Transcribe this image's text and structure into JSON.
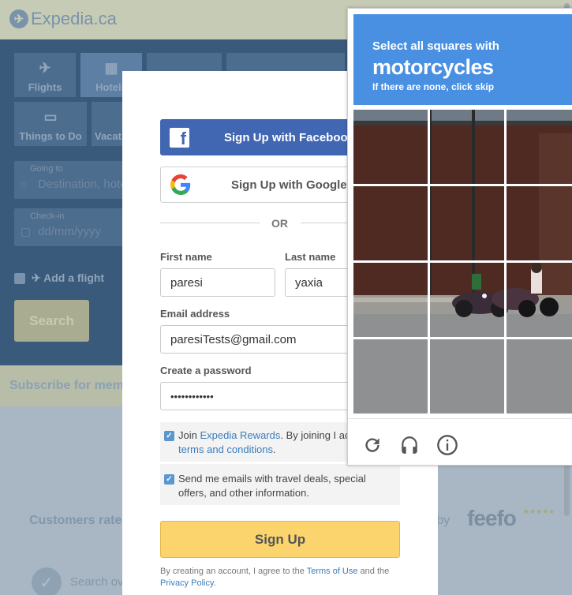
{
  "background": {
    "logo_text": "Expedia.ca",
    "tabs": [
      {
        "label": "Flights",
        "icon": "airplane-icon"
      },
      {
        "label": "Hotels",
        "icon": "hotel-icon"
      },
      {
        "label": "Things to Do",
        "icon": "ticket-icon"
      },
      {
        "label": "Vacations",
        "icon": "vacation-icon"
      }
    ],
    "going_to_label": "Going to",
    "going_to_placeholder": "Destination, hotel name",
    "checkin_label": "Check-in",
    "checkin_placeholder": "dd/mm/yyyy",
    "add_flight": "Add a flight",
    "search_button": "Search",
    "subscribe_text": "Subscribe for members",
    "customers_rated": "Customers rated",
    "rated_by": "d by",
    "feefo": "feefo",
    "search_over": "Search ov"
  },
  "signup": {
    "facebook_button": "Sign Up with Facebook",
    "google_button": "Sign Up with Google",
    "or_text": "OR",
    "first_name_label": "First name",
    "first_name_value": "paresi",
    "last_name_label": "Last name",
    "last_name_value": "yaxia",
    "email_label": "Email address",
    "email_value": "paresiTests@gmail.com",
    "password_label": "Create a password",
    "password_value": "••••••••••••",
    "rewards_pre": "Join ",
    "rewards_link": "Expedia Rewards",
    "rewards_post": ". By joining I ac",
    "rewards_terms": "terms and conditions",
    "rewards_end": ".",
    "rewards_checked": true,
    "emails_text": "Send me emails with travel deals, special offers, and other information.",
    "emails_checked": true,
    "signup_button": "Sign Up",
    "legal_pre": "By creating an account, I agree to the ",
    "legal_terms": "Terms of Use",
    "legal_mid": " and the",
    "legal_privacy": "Privacy Policy",
    "legal_end": "."
  },
  "captcha": {
    "instruction": "Select all squares with",
    "target": "motorcycles",
    "hint": "If there are none, click skip",
    "header_color": "#4a90e2",
    "grid_rows": 4,
    "grid_cols": 3,
    "icons": [
      "reload-icon",
      "audio-icon",
      "info-icon"
    ]
  }
}
